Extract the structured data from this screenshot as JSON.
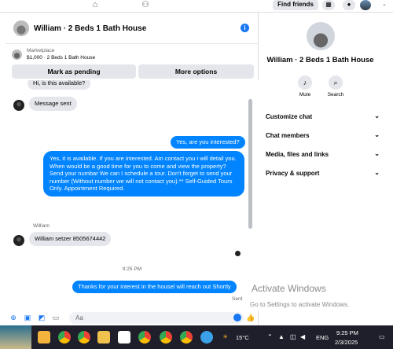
{
  "topnav": {
    "find_friends": "Find friends"
  },
  "chat": {
    "title": "William · 2 Beds 1 Bath House",
    "marketplace_label": "Marketplace",
    "listing": "$1,000 · 2 Beds 1 Bath House",
    "buttons": {
      "mark_pending": "Mark as pending",
      "more_options": "More options"
    },
    "messages": {
      "m1": "Hi, is this available?",
      "m2": "Message sent",
      "m3": "Yes, are you interested?",
      "m4": "Yes, it is available. If you are interested.  Am contact you i will detail you.  When would be a good time for you to come and view the property? Send your numbar We can I schedule a tour.  Don't forget to send your number (Without number we will not contact you).** Self-Guided Tours Only. Appointment Required.",
      "sender_name": "William",
      "m5": "William setzer 8505674442",
      "time_separator": "9:25 PM",
      "m6": "Thanks for your interest in the housel will reach out Shortly",
      "status": "Sent"
    },
    "composer_placeholder": "Aa"
  },
  "sidebar": {
    "title": "William · 2 Beds 1 Bath House",
    "actions": [
      {
        "label": "Mute",
        "icon": "bell-icon"
      },
      {
        "label": "Search",
        "icon": "search-icon"
      }
    ],
    "sections": [
      "Customize chat",
      "Chat members",
      "Media, files and links",
      "Privacy & support"
    ]
  },
  "watermark": {
    "line1": "Activate Windows",
    "line2": "Go to Settings to activate Windows."
  },
  "taskbar": {
    "temperature": "15°C",
    "language": "ENG",
    "time": "9:25 PM",
    "date": "2/3/2025"
  },
  "colors": {
    "messenger_blue": "#0084ff",
    "accent": "#1877f2",
    "bubble_gray": "#e4e6eb",
    "taskbar": "#1f1f2b"
  }
}
